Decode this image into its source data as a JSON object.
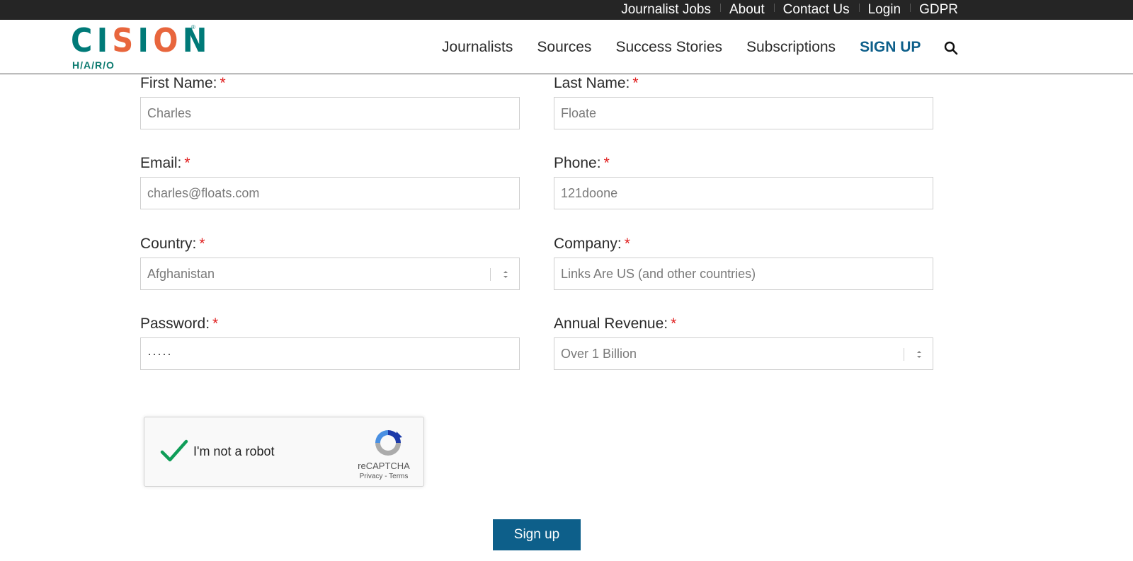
{
  "topbar": {
    "links": [
      "Journalist Jobs",
      "About",
      "Contact Us",
      "Login",
      "GDPR"
    ]
  },
  "logo": {
    "wordmark": "CISION",
    "subbrand": "H/A/R/O",
    "registered": "®",
    "colors": {
      "teal": "#007a78",
      "orange": "#e8663d"
    }
  },
  "nav": {
    "items": [
      "Journalists",
      "Sources",
      "Success Stories",
      "Subscriptions"
    ],
    "signup_label": "SIGN UP",
    "search_icon": "search-icon",
    "signup_color": "#0d5f8a"
  },
  "form": {
    "required_mark": "*",
    "first_name": {
      "label": "First Name:",
      "value": "Charles"
    },
    "last_name": {
      "label": "Last Name:",
      "value": "Floate"
    },
    "email": {
      "label": "Email:",
      "value": "charles@floats.com"
    },
    "phone": {
      "label": "Phone:",
      "value": "121doone"
    },
    "country": {
      "label": "Country:",
      "value": "Afghanistan"
    },
    "company": {
      "label": "Company:",
      "value": "Links Are US (and other countries)"
    },
    "password": {
      "label": "Password:",
      "value": "·····"
    },
    "annual_revenue": {
      "label": "Annual Revenue:",
      "value": "Over 1 Billion"
    }
  },
  "captcha": {
    "label": "I'm not a robot",
    "brand": "reCAPTCHA",
    "terms": "Privacy - Terms",
    "checked": true,
    "check_color": "#0f9d58"
  },
  "submit": {
    "label": "Sign up"
  }
}
